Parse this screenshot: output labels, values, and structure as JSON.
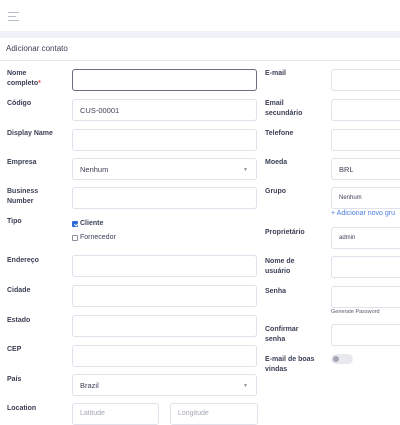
{
  "header": {
    "title": "Adicionar contato"
  },
  "left": {
    "full_name": {
      "label": "Nome completo",
      "required_mark": "*",
      "value": ""
    },
    "code": {
      "label": "Código",
      "value": "CUS-00001"
    },
    "display_name": {
      "label": "Display Name",
      "value": ""
    },
    "company": {
      "label": "Empresa",
      "value": "Nenhum"
    },
    "business_number": {
      "label": "Business Number",
      "value": ""
    },
    "type": {
      "label": "Tipo",
      "options": [
        {
          "label": "Cliente",
          "checked": true
        },
        {
          "label": "Fornecedor",
          "checked": false
        }
      ]
    },
    "address": {
      "label": "Endereço",
      "value": ""
    },
    "city": {
      "label": "Cidade",
      "value": ""
    },
    "state": {
      "label": "Estado",
      "value": ""
    },
    "zip": {
      "label": "CEP",
      "value": ""
    },
    "country": {
      "label": "País",
      "value": "Brazil"
    },
    "location": {
      "label": "Location",
      "lat_placeholder": "Latitude",
      "lng_placeholder": "Longitude"
    }
  },
  "right": {
    "email": {
      "label": "E-mail",
      "value": ""
    },
    "email2": {
      "label": "Email secundário",
      "value": ""
    },
    "phone": {
      "label": "Telefone",
      "value": ""
    },
    "currency": {
      "label": "Moeda",
      "value": "BRL"
    },
    "group": {
      "label": "Grupo",
      "value": "Nenhum",
      "add_link": "+ Adicionar novo gru"
    },
    "owner": {
      "label": "Proprietário",
      "value": "admin"
    },
    "username": {
      "label": "Nome de usuário",
      "value": ""
    },
    "password": {
      "label": "Senha",
      "value": "",
      "generate": "Generate Password"
    },
    "confirm": {
      "label": "Confirmar senha",
      "value": ""
    },
    "welcome_email": {
      "label": "E-mail de boas vindas",
      "enabled": false
    }
  }
}
